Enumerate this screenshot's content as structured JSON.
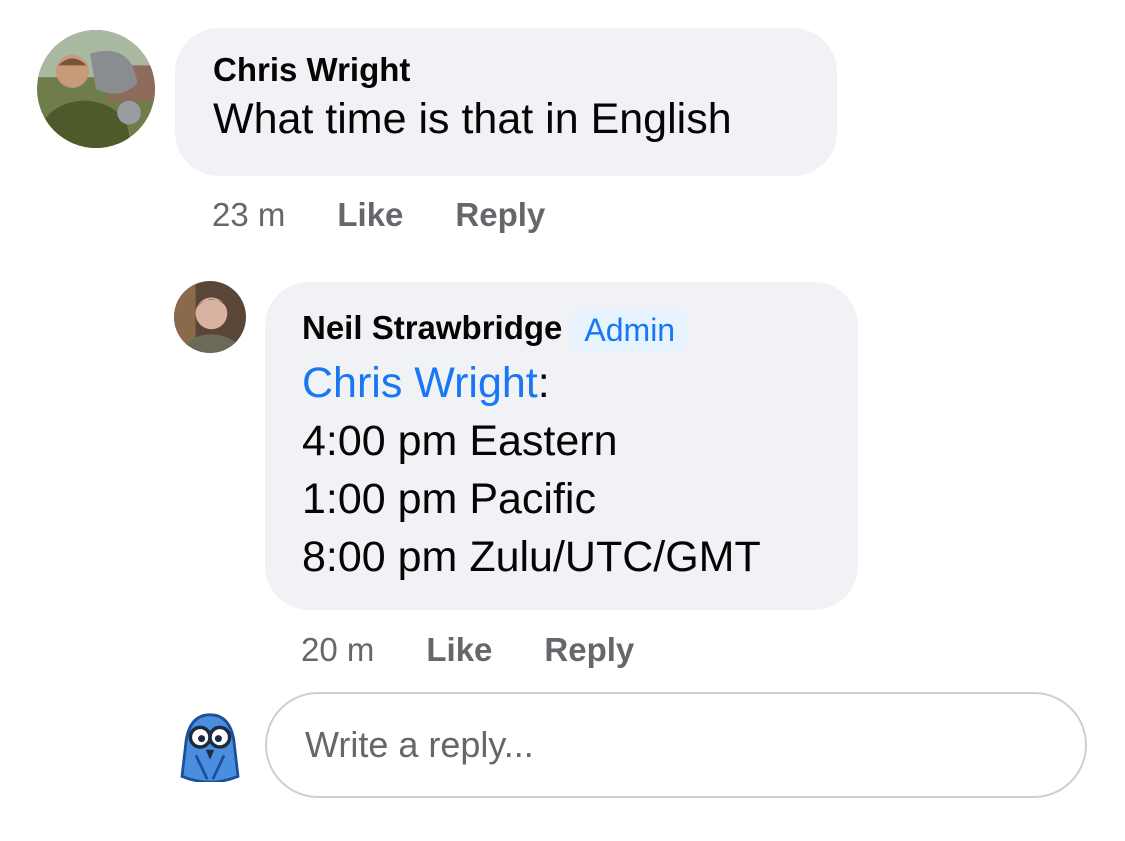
{
  "comments": [
    {
      "author": "Chris Wright",
      "text": "What time is that in English",
      "time": "23 m",
      "like_label": "Like",
      "reply_label": "Reply"
    },
    {
      "author": "Neil Strawbridge",
      "badge": "Admin",
      "mention": "Chris Wright",
      "mention_suffix": ":",
      "lines": [
        "4:00 pm Eastern",
        "1:00 pm Pacific",
        "8:00 pm Zulu/UTC/GMT"
      ],
      "time": "20 m",
      "like_label": "Like",
      "reply_label": "Reply"
    }
  ],
  "reply_input": {
    "placeholder": "Write a reply..."
  },
  "colors": {
    "bubble": "#f0f2f5",
    "link": "#1877f2",
    "muted": "#65676b",
    "badge_bg": "#e7f3ff"
  }
}
